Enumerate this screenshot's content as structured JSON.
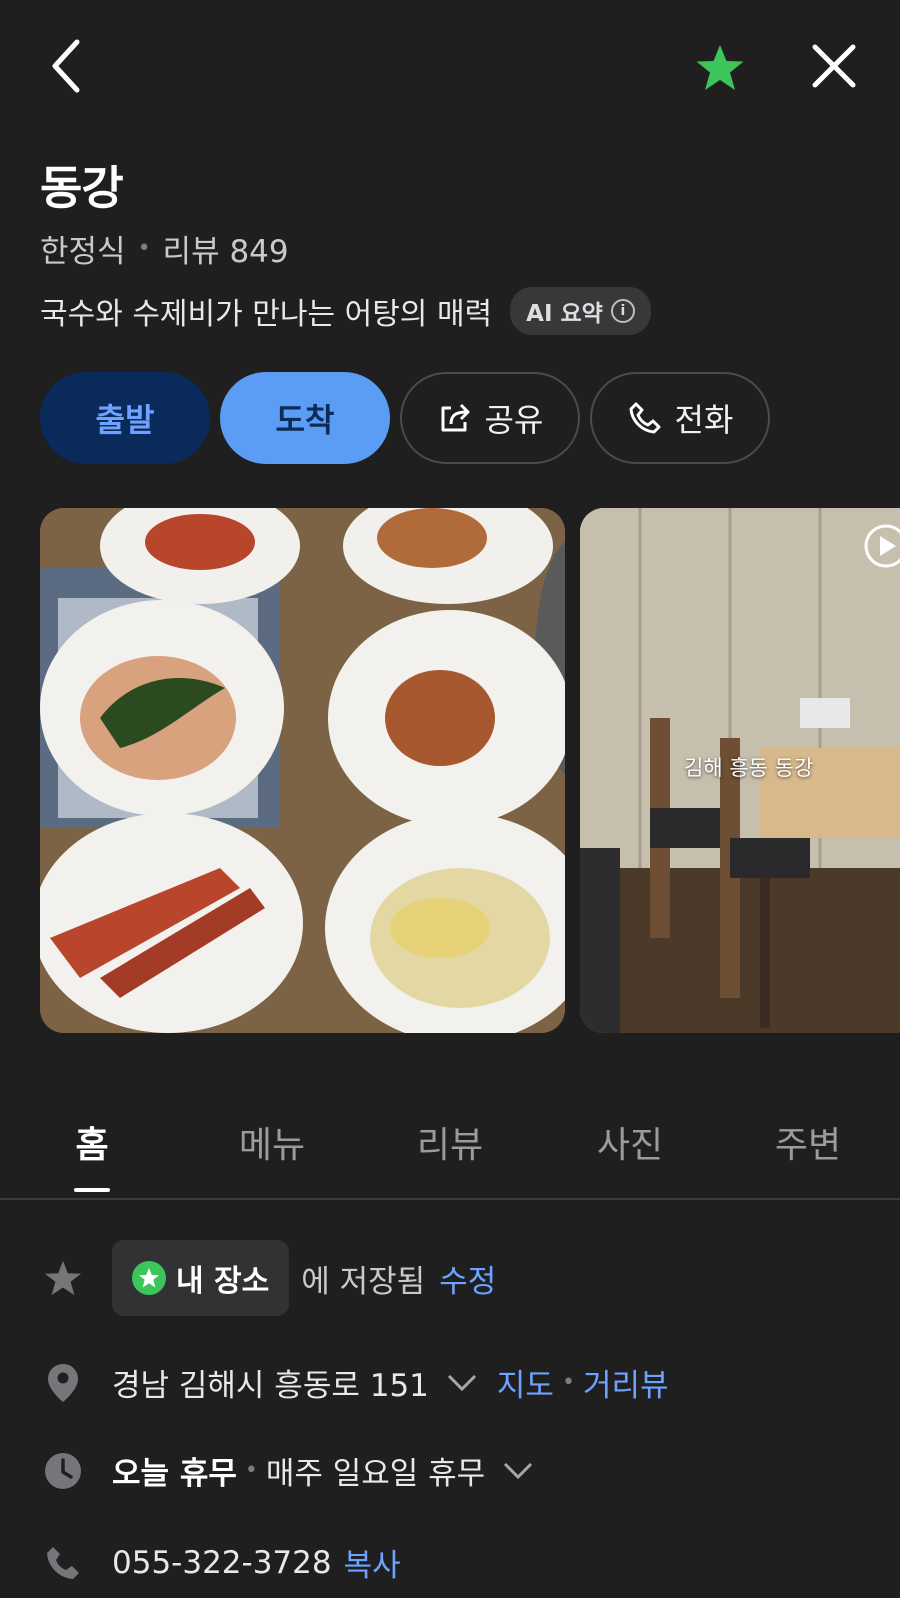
{
  "place": {
    "name": "동강",
    "category": "한정식",
    "review_label": "리뷰 849",
    "summary": "국수와 수제비가 만나는 어탕의 매력",
    "ai_badge": "AI 요약"
  },
  "actions": {
    "depart": "출발",
    "arrive": "도착",
    "share": "공유",
    "call": "전화"
  },
  "photos": {
    "caption_2": "김해 흥동 동강"
  },
  "tabs": [
    "홈",
    "메뉴",
    "리뷰",
    "사진",
    "주변"
  ],
  "info": {
    "saved_chip": "내 장소",
    "saved_text": "에 저장됨",
    "edit_link": "수정",
    "address": "경남 김해시 흥동로 151",
    "map_link": "지도",
    "streetview_link": "거리뷰",
    "hours_status": "오늘 휴무",
    "hours_detail": "매주 일요일 휴무",
    "phone": "055-322-3728",
    "copy_link": "복사"
  },
  "colors": {
    "background": "#1f1f20",
    "accent_blue": "#5b9cf5",
    "favorite_green": "#3cc55b"
  }
}
